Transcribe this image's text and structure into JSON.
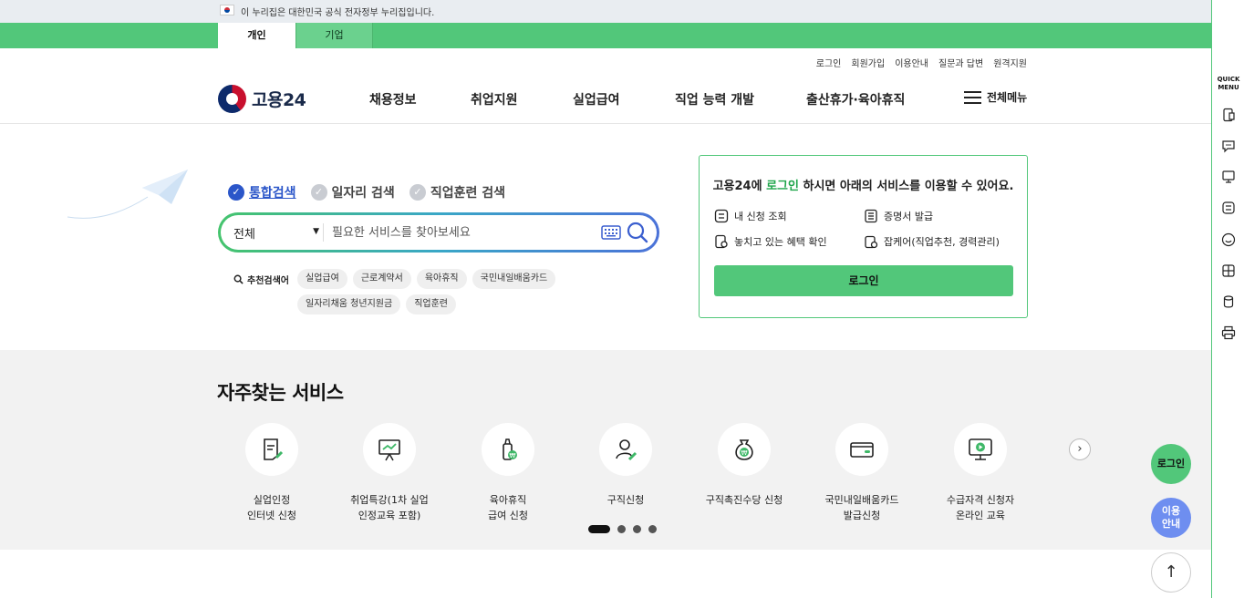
{
  "gov_banner": {
    "text": "이 누리집은 대한민국 공식 전자정부 누리집입니다."
  },
  "user_type": {
    "personal": "개인",
    "corporate": "기업"
  },
  "util_links": [
    "로그인",
    "회원가입",
    "이용안내",
    "질문과 답변",
    "원격지원"
  ],
  "logo": {
    "text": "고용24"
  },
  "gnb": [
    "채용정보",
    "취업지원",
    "실업급여",
    "직업 능력 개발",
    "출산휴가·육아휴직"
  ],
  "all_menu": "전체메뉴",
  "search": {
    "tabs": [
      "통합검색",
      "일자리 검색",
      "직업훈련 검색"
    ],
    "category": "전체",
    "placeholder": "필요한 서비스를 찾아보세요",
    "rec_label": "추천검색어",
    "keywords": [
      "실업급여",
      "근로계약서",
      "육아휴직",
      "국민내일배움카드",
      "일자리채움 청년지원금",
      "직업훈련"
    ]
  },
  "login_card": {
    "title_pre": "고용24에 ",
    "title_link": "로그인",
    "title_post": " 하시면 아래의 서비스를 이용할 수 있어요.",
    "services": [
      "내 신청 조회",
      "증명서 발급",
      "놓치고 있는 혜택 확인",
      "잡케어(직업추천, 경력관리)"
    ],
    "button": "로그인"
  },
  "frequent": {
    "heading": "자주찾는 서비스",
    "items": [
      {
        "label": "실업인정\n인터넷 신청",
        "icon": "document-edit-icon"
      },
      {
        "label": "취업특강(1차 실업\n인정교육 포함)",
        "icon": "presentation-board-icon"
      },
      {
        "label": "육아휴직\n급여 신청",
        "icon": "baby-bottle-icon"
      },
      {
        "label": "구직신청",
        "icon": "person-edit-icon"
      },
      {
        "label": "구직촉진수당 신청",
        "icon": "money-bag-icon"
      },
      {
        "label": "국민내일배움카드\n발급신청",
        "icon": "card-icon"
      },
      {
        "label": "수급자격 신청자\n온라인 교육",
        "icon": "monitor-play-icon"
      }
    ]
  },
  "quick_menu": {
    "title": "QUICK\nMENU"
  },
  "floating": {
    "login": "로그인",
    "guide": "이용\n안내"
  },
  "colors": {
    "brand_green": "#52c77a",
    "accent_blue": "#2b56c9"
  }
}
